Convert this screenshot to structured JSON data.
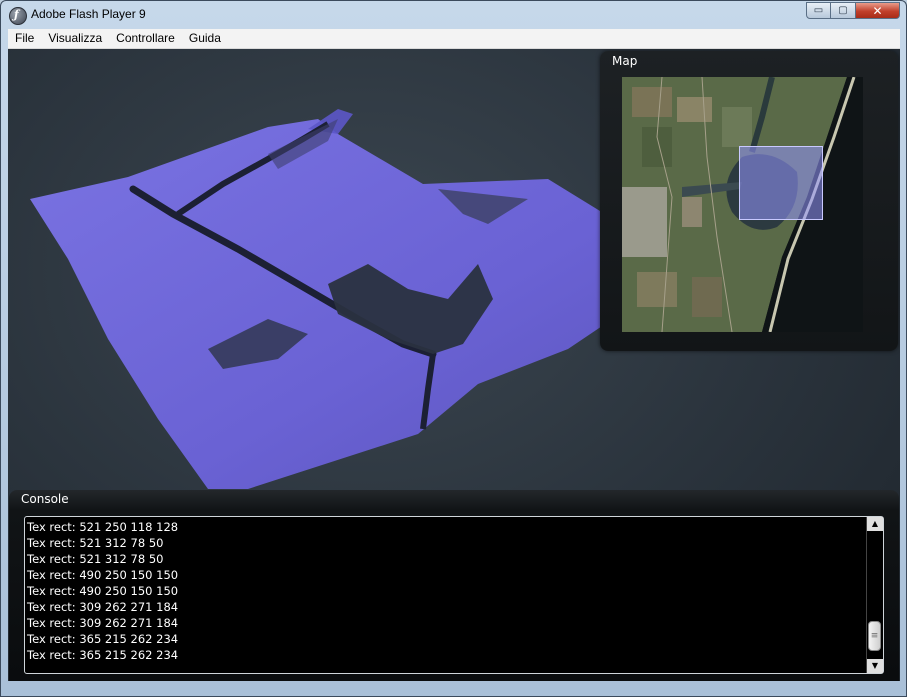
{
  "window": {
    "title": "Adobe Flash Player 9",
    "icon": "flash-player-icon",
    "controls": {
      "minimize": "▭",
      "maximize": "▢",
      "close": "✕"
    }
  },
  "menubar": {
    "items": [
      "File",
      "Visualizza",
      "Controllare",
      "Guida"
    ]
  },
  "map_panel": {
    "title": "Map"
  },
  "console_panel": {
    "title": "Console",
    "lines": [
      "Tex rect: 521 250 118 128",
      "Tex rect: 521 312 78 50",
      "Tex rect: 521 312 78 50",
      "Tex rect: 490 250 150 150",
      "Tex rect: 490 250 150 150",
      "Tex rect: 309 262 271 184",
      "Tex rect: 309 262 271 184",
      "Tex rect: 365 215 262 234",
      "Tex rect: 365 215 262 234"
    ],
    "scroll_up_icon": "▲",
    "scroll_down_icon": "▼",
    "scroll_grip": "≡"
  },
  "colors": {
    "terrain": "#6a62d4",
    "stage_bg": "#2a333c",
    "panel_bg": "#121517"
  }
}
